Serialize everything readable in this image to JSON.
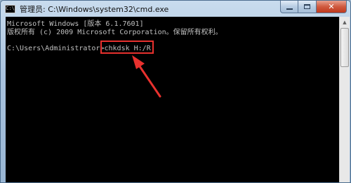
{
  "window": {
    "title": "管理员: C:\\Windows\\system32\\cmd.exe",
    "icon": "cmd-console-icon",
    "icon_glyph": "C:\\",
    "buttons": {
      "minimize": "minimize-icon",
      "maximize": "maximize-icon",
      "close": "✕"
    }
  },
  "console": {
    "lines": [
      "Microsoft Windows [版本 6.1.7601]",
      "版权所有 (c) 2009 Microsoft Corporation。保留所有权利。",
      "",
      "C:\\Users\\Administrator>chkdsk H:/R"
    ],
    "prompt": "C:\\Users\\Administrator>",
    "command": "chkdsk H:/R",
    "text_color": "#c0c0c0",
    "background": "#000000"
  },
  "annotation": {
    "highlight_color": "#e8312e",
    "arrow": "red-arrow-pointing-to-command"
  },
  "scrollbar": {
    "up_arrow": "▲"
  }
}
